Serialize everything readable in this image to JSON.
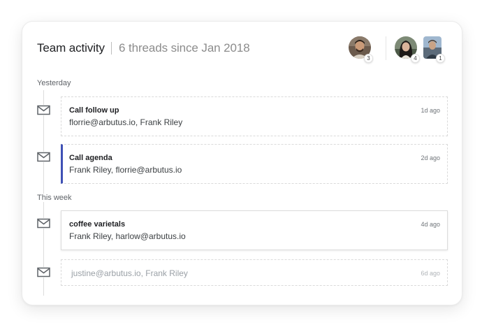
{
  "header": {
    "title": "Team activity",
    "subtitle": "6 threads since Jan 2018"
  },
  "participants": [
    {
      "count": "3"
    },
    {
      "count": "4"
    },
    {
      "count": "1"
    }
  ],
  "sections": [
    {
      "label": "Yesterday"
    },
    {
      "label": "This week"
    }
  ],
  "threads": [
    {
      "title": "Call follow up",
      "people": "florrie@arbutus.io, Frank Riley",
      "time": "1d ago"
    },
    {
      "title": "Call agenda",
      "people": "Frank Riley, florrie@arbutus.io",
      "time": "2d ago"
    },
    {
      "title": "coffee varietals",
      "people": "Frank Riley, harlow@arbutus.io",
      "time": "4d ago"
    },
    {
      "title": "",
      "people": "justine@arbutus.io, Frank Riley",
      "time": "6d ago"
    }
  ],
  "icons": {
    "thread_icon": "mail-icon"
  },
  "colors": {
    "accent": "#3f51b5"
  }
}
